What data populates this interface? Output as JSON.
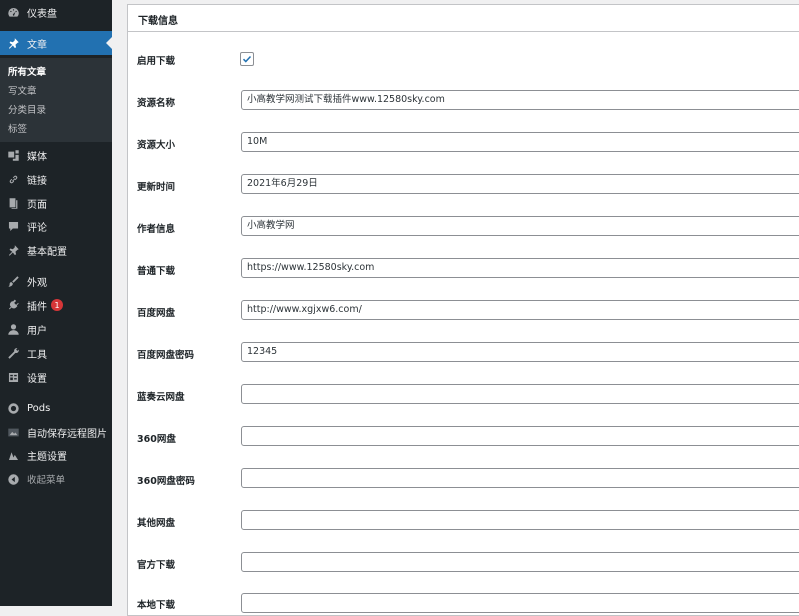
{
  "sidebar": {
    "dashboard": "仪表盘",
    "posts": "文章",
    "posts_sub": [
      "所有文章",
      "写文章",
      "分类目录",
      "标签"
    ],
    "media": "媒体",
    "links": "链接",
    "pages": "页面",
    "comments": "评论",
    "basic_config": "基本配置",
    "appearance": "外观",
    "plugins": "插件",
    "plugins_badge": "1",
    "users": "用户",
    "tools": "工具",
    "settings": "设置",
    "pods": "Pods",
    "auto_save": "自动保存远程图片",
    "theme_settings": "主题设置",
    "collapse": "收起菜单"
  },
  "panel": {
    "title": "下载信息",
    "enable_label": "启用下载",
    "enable_checked": true,
    "fields": [
      {
        "label": "资源名称",
        "value": "小高教学网测试下载插件www.12580sky.com"
      },
      {
        "label": "资源大小",
        "value": "10M"
      },
      {
        "label": "更新时间",
        "value": "2021年6月29日"
      },
      {
        "label": "作者信息",
        "value": "小高教学网"
      },
      {
        "label": "普通下载",
        "value": "https://www.12580sky.com"
      },
      {
        "label": "百度网盘",
        "value": "http://www.xgjxw6.com/"
      },
      {
        "label": "百度网盘密码",
        "value": "12345"
      },
      {
        "label": "蓝奏云网盘",
        "value": ""
      },
      {
        "label": "360网盘",
        "value": ""
      },
      {
        "label": "360网盘密码",
        "value": ""
      },
      {
        "label": "其他网盘",
        "value": ""
      },
      {
        "label": "官方下载",
        "value": ""
      },
      {
        "label": "本地下载",
        "value": ""
      }
    ]
  },
  "colors": {
    "sidebar_bg": "#1d2327",
    "active_bg": "#2271b1",
    "check": "#2271b1"
  }
}
